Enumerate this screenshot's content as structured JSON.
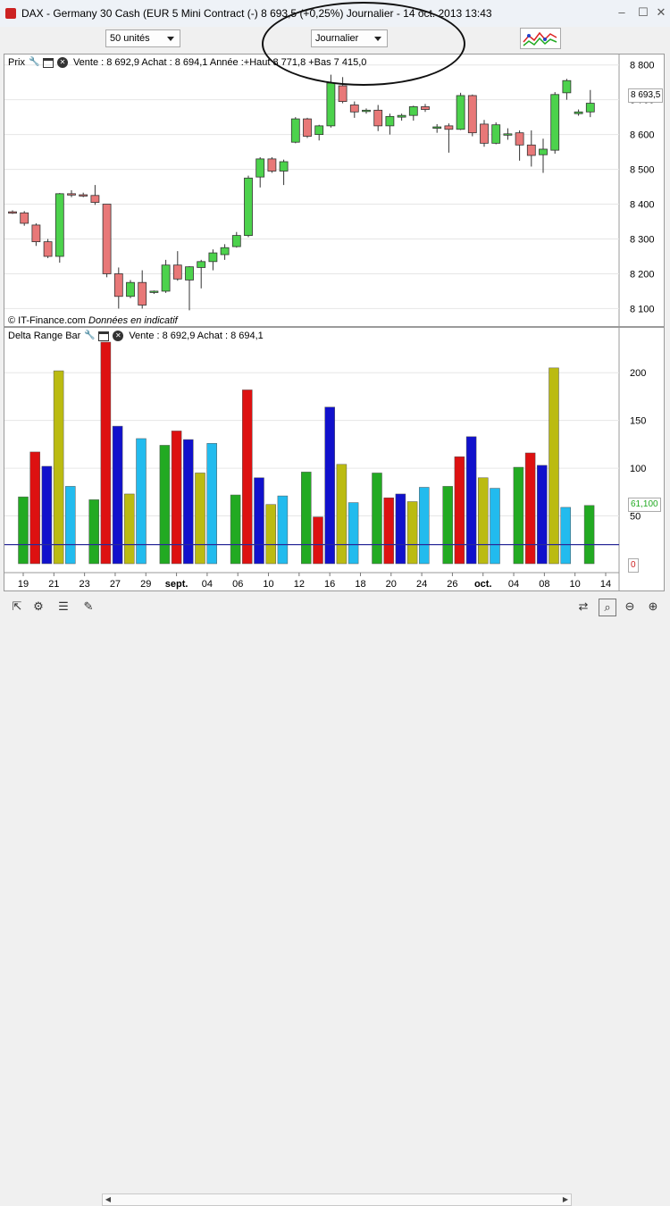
{
  "window": {
    "title": "DAX - Germany 30 Cash (EUR 5 Mini Contract (-)     8 693,5 (+0,25%)     Journalier - 14 oct. 2013 13:43",
    "minimize": "–",
    "maximize": "☐",
    "close": "✕"
  },
  "toolbar": {
    "units": "50 unités",
    "period": "Journalier"
  },
  "price_panel": {
    "name": "Prix",
    "info": "Vente : 8 692,9  Achat : 8 694,1  Année :+Haut 8 771,8 +Bas 7 415,0",
    "credit_prefix": "© IT-Finance.com",
    "credit_suffix": "Données en indicatif",
    "current_price": "8 693,5"
  },
  "delta_panel": {
    "name": "Delta Range Bar",
    "info": "Vente : 8 692,9  Achat : 8 694,1",
    "current_value": "61,100",
    "zero_label": "0"
  },
  "colors": {
    "up": "#4cd24c",
    "down": "#e87878",
    "bar_green": "#22aa22",
    "bar_red": "#dd1111",
    "bar_blue": "#1111cc",
    "bar_olive": "#bbbb11",
    "bar_cyan": "#22bbee",
    "baseline": "#2a2a99"
  },
  "chart_data": [
    {
      "type": "candlestick",
      "y_ticks": [
        "8 800",
        "8 700",
        "8 600",
        "8 500",
        "8 400",
        "8 300",
        "8 200",
        "8 100"
      ],
      "y_tick_values": [
        8800,
        8700,
        8600,
        8500,
        8400,
        8300,
        8200,
        8100
      ],
      "ylim": [
        8060,
        8830
      ],
      "candles": [
        {
          "o": 8378,
          "h": 8382,
          "l": 8372,
          "c": 8375
        },
        {
          "o": 8375,
          "h": 8380,
          "l": 8338,
          "c": 8345
        },
        {
          "o": 8340,
          "h": 8345,
          "l": 8280,
          "c": 8292
        },
        {
          "o": 8292,
          "h": 8300,
          "l": 8245,
          "c": 8250
        },
        {
          "o": 8250,
          "h": 8432,
          "l": 8232,
          "c": 8430
        },
        {
          "o": 8430,
          "h": 8440,
          "l": 8420,
          "c": 8427
        },
        {
          "o": 8427,
          "h": 8433,
          "l": 8420,
          "c": 8426
        },
        {
          "o": 8425,
          "h": 8455,
          "l": 8398,
          "c": 8405
        },
        {
          "o": 8400,
          "h": 8400,
          "l": 8190,
          "c": 8200
        },
        {
          "o": 8200,
          "h": 8218,
          "l": 8100,
          "c": 8135
        },
        {
          "o": 8135,
          "h": 8182,
          "l": 8130,
          "c": 8175
        },
        {
          "o": 8175,
          "h": 8210,
          "l": 8100,
          "c": 8110
        },
        {
          "o": 8148,
          "h": 8152,
          "l": 8142,
          "c": 8150
        },
        {
          "o": 8150,
          "h": 8240,
          "l": 8145,
          "c": 8225
        },
        {
          "o": 8225,
          "h": 8265,
          "l": 8180,
          "c": 8185
        },
        {
          "o": 8182,
          "h": 8222,
          "l": 8095,
          "c": 8220
        },
        {
          "o": 8218,
          "h": 8240,
          "l": 8158,
          "c": 8235
        },
        {
          "o": 8235,
          "h": 8270,
          "l": 8210,
          "c": 8260
        },
        {
          "o": 8255,
          "h": 8285,
          "l": 8240,
          "c": 8275
        },
        {
          "o": 8278,
          "h": 8320,
          "l": 8275,
          "c": 8310
        },
        {
          "o": 8310,
          "h": 8482,
          "l": 8305,
          "c": 8475
        },
        {
          "o": 8478,
          "h": 8535,
          "l": 8448,
          "c": 8530
        },
        {
          "o": 8530,
          "h": 8535,
          "l": 8490,
          "c": 8495
        },
        {
          "o": 8495,
          "h": 8528,
          "l": 8455,
          "c": 8522
        },
        {
          "o": 8578,
          "h": 8650,
          "l": 8575,
          "c": 8645
        },
        {
          "o": 8645,
          "h": 8648,
          "l": 8590,
          "c": 8595
        },
        {
          "o": 8600,
          "h": 8628,
          "l": 8583,
          "c": 8625
        },
        {
          "o": 8625,
          "h": 8772,
          "l": 8620,
          "c": 8748
        },
        {
          "o": 8740,
          "h": 8765,
          "l": 8690,
          "c": 8695
        },
        {
          "o": 8685,
          "h": 8695,
          "l": 8648,
          "c": 8665
        },
        {
          "o": 8668,
          "h": 8675,
          "l": 8660,
          "c": 8670
        },
        {
          "o": 8670,
          "h": 8685,
          "l": 8610,
          "c": 8625
        },
        {
          "o": 8625,
          "h": 8660,
          "l": 8600,
          "c": 8652
        },
        {
          "o": 8650,
          "h": 8660,
          "l": 8640,
          "c": 8655
        },
        {
          "o": 8655,
          "h": 8683,
          "l": 8640,
          "c": 8680
        },
        {
          "o": 8680,
          "h": 8688,
          "l": 8665,
          "c": 8672
        },
        {
          "o": 8618,
          "h": 8630,
          "l": 8605,
          "c": 8622
        },
        {
          "o": 8625,
          "h": 8632,
          "l": 8548,
          "c": 8615
        },
        {
          "o": 8615,
          "h": 8720,
          "l": 8613,
          "c": 8712
        },
        {
          "o": 8712,
          "h": 8715,
          "l": 8595,
          "c": 8605
        },
        {
          "o": 8630,
          "h": 8642,
          "l": 8565,
          "c": 8575
        },
        {
          "o": 8575,
          "h": 8635,
          "l": 8572,
          "c": 8628
        },
        {
          "o": 8600,
          "h": 8618,
          "l": 8585,
          "c": 8602
        },
        {
          "o": 8605,
          "h": 8612,
          "l": 8525,
          "c": 8570
        },
        {
          "o": 8570,
          "h": 8612,
          "l": 8508,
          "c": 8540
        },
        {
          "o": 8542,
          "h": 8588,
          "l": 8490,
          "c": 8558
        },
        {
          "o": 8555,
          "h": 8722,
          "l": 8545,
          "c": 8715
        },
        {
          "o": 8720,
          "h": 8760,
          "l": 8700,
          "c": 8755
        },
        {
          "o": 8660,
          "h": 8672,
          "l": 8654,
          "c": 8665
        },
        {
          "o": 8665,
          "h": 8728,
          "l": 8650,
          "c": 8690
        }
      ]
    },
    {
      "type": "bar",
      "y_ticks": [
        "200",
        "150",
        "100",
        "50"
      ],
      "y_tick_values": [
        200,
        150,
        100,
        50
      ],
      "ylim": [
        0,
        232
      ],
      "baseline_value": 20,
      "x_ticks": [
        "19",
        "21",
        "23",
        "27",
        "29",
        "sept.",
        "04",
        "06",
        "10",
        "12",
        "16",
        "18",
        "20",
        "24",
        "26",
        "oct.",
        "04",
        "08",
        "10",
        "14"
      ],
      "x_tick_index": [
        0,
        2,
        4,
        6,
        8,
        10,
        12,
        14,
        16,
        18,
        20,
        22,
        24,
        26,
        28,
        30,
        32,
        34,
        36,
        38
      ],
      "bars": [
        {
          "v": 70,
          "c": "green"
        },
        {
          "v": 117,
          "c": "red"
        },
        {
          "v": 102,
          "c": "blue"
        },
        {
          "v": 202,
          "c": "olive"
        },
        {
          "v": 81,
          "c": "cyan"
        },
        {
          "v": 67,
          "c": "green"
        },
        {
          "v": 232,
          "c": "red"
        },
        {
          "v": 144,
          "c": "blue"
        },
        {
          "v": 73,
          "c": "olive"
        },
        {
          "v": 131,
          "c": "cyan"
        },
        {
          "v": 124,
          "c": "green"
        },
        {
          "v": 139,
          "c": "red"
        },
        {
          "v": 130,
          "c": "blue"
        },
        {
          "v": 95,
          "c": "olive"
        },
        {
          "v": 126,
          "c": "cyan"
        },
        {
          "v": 72,
          "c": "green"
        },
        {
          "v": 182,
          "c": "red"
        },
        {
          "v": 90,
          "c": "blue"
        },
        {
          "v": 62,
          "c": "olive"
        },
        {
          "v": 71,
          "c": "cyan"
        },
        {
          "v": 96,
          "c": "green"
        },
        {
          "v": 49,
          "c": "red"
        },
        {
          "v": 164,
          "c": "blue"
        },
        {
          "v": 104,
          "c": "olive"
        },
        {
          "v": 64,
          "c": "cyan"
        },
        {
          "v": 95,
          "c": "green"
        },
        {
          "v": 69,
          "c": "red"
        },
        {
          "v": 73,
          "c": "blue"
        },
        {
          "v": 65,
          "c": "olive"
        },
        {
          "v": 80,
          "c": "cyan"
        },
        {
          "v": 81,
          "c": "green"
        },
        {
          "v": 112,
          "c": "red"
        },
        {
          "v": 133,
          "c": "blue"
        },
        {
          "v": 90,
          "c": "olive"
        },
        {
          "v": 79,
          "c": "cyan"
        },
        {
          "v": 101,
          "c": "green"
        },
        {
          "v": 116,
          "c": "red"
        },
        {
          "v": 103,
          "c": "blue"
        },
        {
          "v": 205,
          "c": "olive"
        },
        {
          "v": 59,
          "c": "cyan"
        },
        {
          "v": 61,
          "c": "green"
        }
      ]
    }
  ],
  "icons": {
    "bottom": [
      "cursor-icon",
      "indicators-icon",
      "list-icon",
      "drawing-icon",
      "scroll-left-icon",
      "scroll-right-icon",
      "sync-icon",
      "zoom-fit-icon",
      "zoom-out-icon",
      "zoom-in-icon"
    ]
  }
}
